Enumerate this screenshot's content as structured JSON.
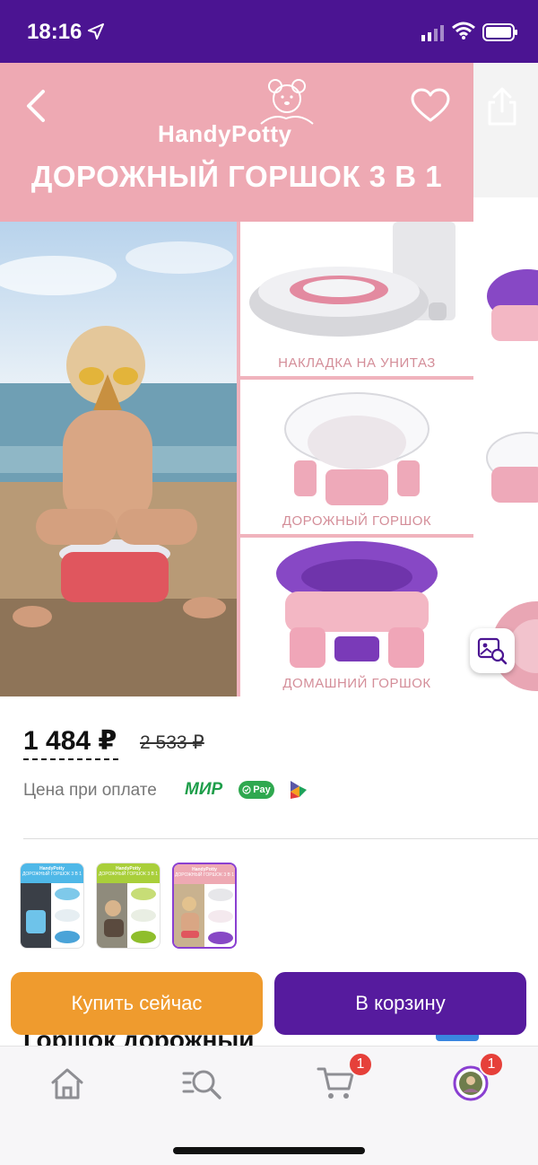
{
  "status_bar": {
    "time": "18:16"
  },
  "gallery": {
    "brand": "HandyPotty",
    "headline": "ДОРОЖНЫЙ ГОРШОК 3 В 1",
    "panels": [
      {
        "label": "НАКЛАДКА НА УНИТАЗ"
      },
      {
        "label": "ДОРОЖНЫЙ ГОРШОК"
      },
      {
        "label": "ДОМАШНИЙ ГОРШОК"
      }
    ]
  },
  "price": {
    "current": "1 484 ₽",
    "old": "2 533 ₽",
    "note": "Цена при оплате",
    "mir": "МИР",
    "pay": "Pay"
  },
  "thumbnails": [
    {
      "brand": "HandyPotty",
      "sub": "ДОРОЖНЫЙ ГОРШОК 3 В 1",
      "color": "#4fb8e8"
    },
    {
      "brand": "HandyPotty",
      "sub": "ДОРОЖНЫЙ ГОРШОК 3 В 1",
      "color": "#a9cf3a"
    },
    {
      "brand": "HandyPotty",
      "sub": "ДОРОЖНЫЙ ГОРШОК 3 В 1",
      "color": "#eea9b3",
      "selected": true
    }
  ],
  "product_title_peek": "Горшок дорожный",
  "actions": {
    "buy_now": "Купить сейчас",
    "add_to_cart": "В корзину"
  },
  "tab_bar": {
    "cart_badge": "1",
    "profile_badge": "1"
  },
  "colors": {
    "brand_purple": "#561b9e",
    "buy_orange": "#ef9b2e",
    "banner_pink": "#eea9b3",
    "badge_red": "#e6403a"
  }
}
